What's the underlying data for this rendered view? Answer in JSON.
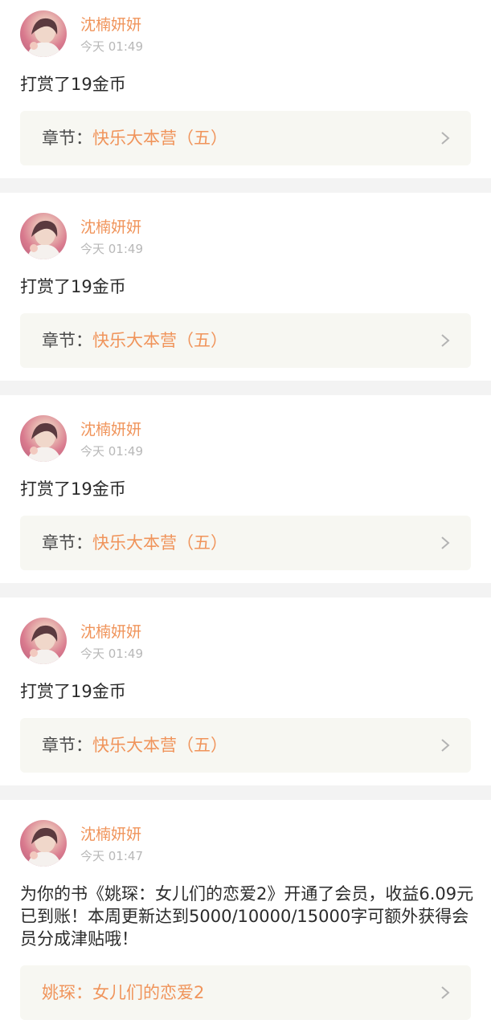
{
  "items": [
    {
      "username": "沈楠妍妍",
      "time": "今天 01:49",
      "message": "打赏了19金币",
      "link": {
        "label": "章节：",
        "value": "快乐大本营（五）"
      }
    },
    {
      "username": "沈楠妍妍",
      "time": "今天 01:49",
      "message": "打赏了19金币",
      "link": {
        "label": "章节：",
        "value": "快乐大本营（五）"
      }
    },
    {
      "username": "沈楠妍妍",
      "time": "今天 01:49",
      "message": "打赏了19金币",
      "link": {
        "label": "章节：",
        "value": "快乐大本营（五）"
      }
    },
    {
      "username": "沈楠妍妍",
      "time": "今天 01:49",
      "message": "打赏了19金币",
      "link": {
        "label": "章节：",
        "value": "快乐大本营（五）"
      }
    },
    {
      "username": "沈楠妍妍",
      "time": "今天 01:47",
      "message": "为你的书《姚琛：女儿们的恋爱2》开通了会员，收益6.09元已到账！本周更新达到5000/10000/15000字可额外获得会员分成津贴哦！",
      "link": {
        "label": "",
        "value": "姚琛：女儿们的恋爱2"
      }
    }
  ],
  "icons": {
    "avatar": "user-avatar-photo",
    "chevron": "chevron-right-icon"
  },
  "colors": {
    "accent": "#f0945b",
    "muted": "#b8b8b8",
    "text": "#2b2b2b",
    "page_background": "#f3f3f3",
    "link_box_background": "#f7f7f2"
  }
}
